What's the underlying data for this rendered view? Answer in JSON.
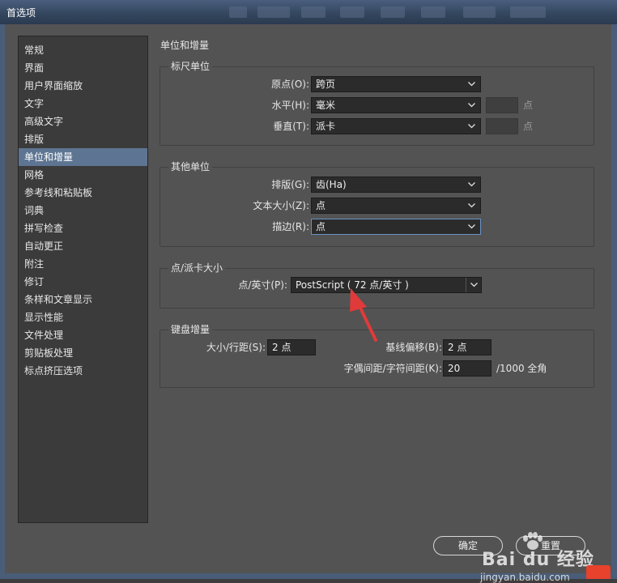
{
  "window": {
    "title": "首选项"
  },
  "sidebar": {
    "items": [
      {
        "label": "常规",
        "selected": false
      },
      {
        "label": "界面",
        "selected": false
      },
      {
        "label": "用户界面缩放",
        "selected": false
      },
      {
        "label": "文字",
        "selected": false
      },
      {
        "label": "高级文字",
        "selected": false
      },
      {
        "label": "排版",
        "selected": false
      },
      {
        "label": "单位和增量",
        "selected": true
      },
      {
        "label": "网格",
        "selected": false
      },
      {
        "label": "参考线和粘贴板",
        "selected": false
      },
      {
        "label": "词典",
        "selected": false
      },
      {
        "label": "拼写检查",
        "selected": false
      },
      {
        "label": "自动更正",
        "selected": false
      },
      {
        "label": "附注",
        "selected": false
      },
      {
        "label": "修订",
        "selected": false
      },
      {
        "label": "条样和文章显示",
        "selected": false
      },
      {
        "label": "显示性能",
        "selected": false
      },
      {
        "label": "文件处理",
        "selected": false
      },
      {
        "label": "剪贴板处理",
        "selected": false
      },
      {
        "label": "标点挤压选项",
        "selected": false
      }
    ]
  },
  "panel": {
    "title": "单位和增量",
    "ruler_units": {
      "label": "标尺单位",
      "origin": {
        "label": "原点(O):",
        "value": "跨页"
      },
      "horizontal": {
        "label": "水平(H):",
        "value": "毫米",
        "number": "",
        "unit": "点"
      },
      "vertical": {
        "label": "垂直(T):",
        "value": "派卡",
        "number": "",
        "unit": "点"
      }
    },
    "other_units": {
      "label": "其他单位",
      "composition": {
        "label": "排版(G):",
        "value": "齿(Ha)"
      },
      "text_size": {
        "label": "文本大小(Z):",
        "value": "点"
      },
      "stroke": {
        "label": "描边(R):",
        "value": "点"
      }
    },
    "point_pica": {
      "label": "点/派卡大小",
      "points_per_inch": {
        "label": "点/英寸(P):",
        "value": "PostScript ( 72 点/英寸 )"
      }
    },
    "keyboard": {
      "label": "键盘增量",
      "size_leading": {
        "label": "大小/行距(S):",
        "value": "2 点"
      },
      "baseline_shift": {
        "label": "基线偏移(B):",
        "value": "2 点"
      },
      "kerning": {
        "label": "字偶间距/字符间距(K):",
        "value": "20",
        "unit": "/1000 全角"
      }
    }
  },
  "buttons": {
    "ok": "确定",
    "reset": "重置"
  },
  "watermark": {
    "brand": "Bai du 经验",
    "url": "jingyan.baidu.com"
  },
  "colors": {
    "selection": "#5d7592",
    "panel_bg": "#535353",
    "arrow": "#e03a3a"
  }
}
